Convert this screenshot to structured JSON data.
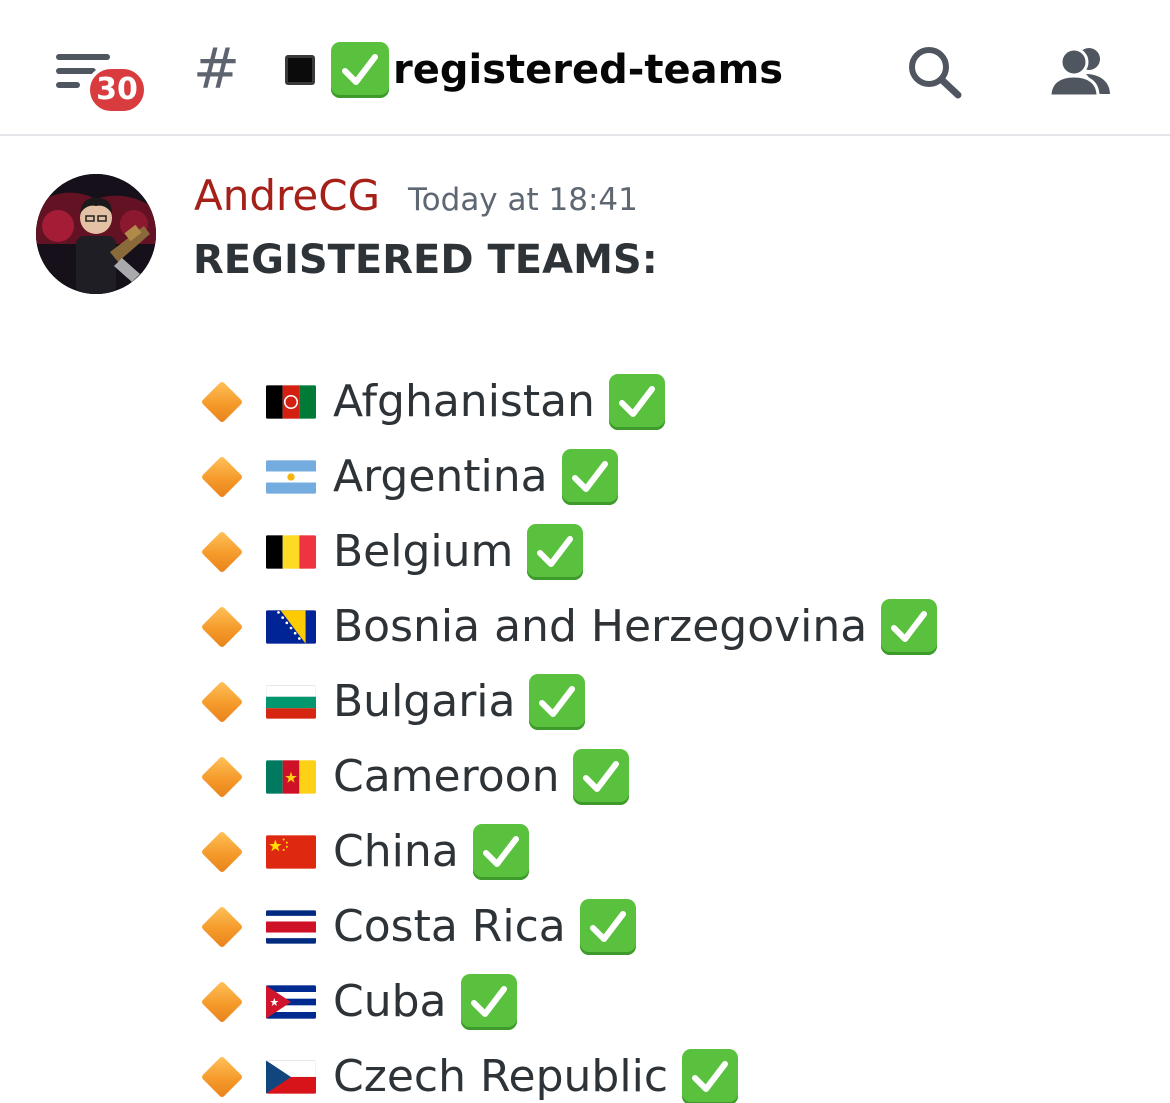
{
  "header": {
    "unread_count": "30",
    "channel_name": "registered-teams",
    "icons": [
      "menu-icon",
      "hash-icon",
      "black-square-icon",
      "check-mark-icon",
      "search-icon",
      "members-icon"
    ]
  },
  "message": {
    "author": "AndreCG",
    "author_color": "#a6201a",
    "timestamp": "Today at 18:41",
    "heading": "REGISTERED TEAMS:",
    "teams": [
      {
        "name": "Afghanistan",
        "flag": "afghanistan-flag"
      },
      {
        "name": "Argentina",
        "flag": "argentina-flag"
      },
      {
        "name": "Belgium",
        "flag": "belgium-flag"
      },
      {
        "name": "Bosnia and Herzegovina",
        "flag": "bosnia-flag"
      },
      {
        "name": "Bulgaria",
        "flag": "bulgaria-flag"
      },
      {
        "name": "Cameroon",
        "flag": "cameroon-flag"
      },
      {
        "name": "China",
        "flag": "china-flag"
      },
      {
        "name": "Costa Rica",
        "flag": "costa-rica-flag"
      },
      {
        "name": "Cuba",
        "flag": "cuba-flag"
      },
      {
        "name": "Czech Republic",
        "flag": "czech-flag"
      }
    ]
  },
  "colors": {
    "badge": "#d83c3e",
    "check": "#5ac13e",
    "diamond": "#f59a2a"
  }
}
